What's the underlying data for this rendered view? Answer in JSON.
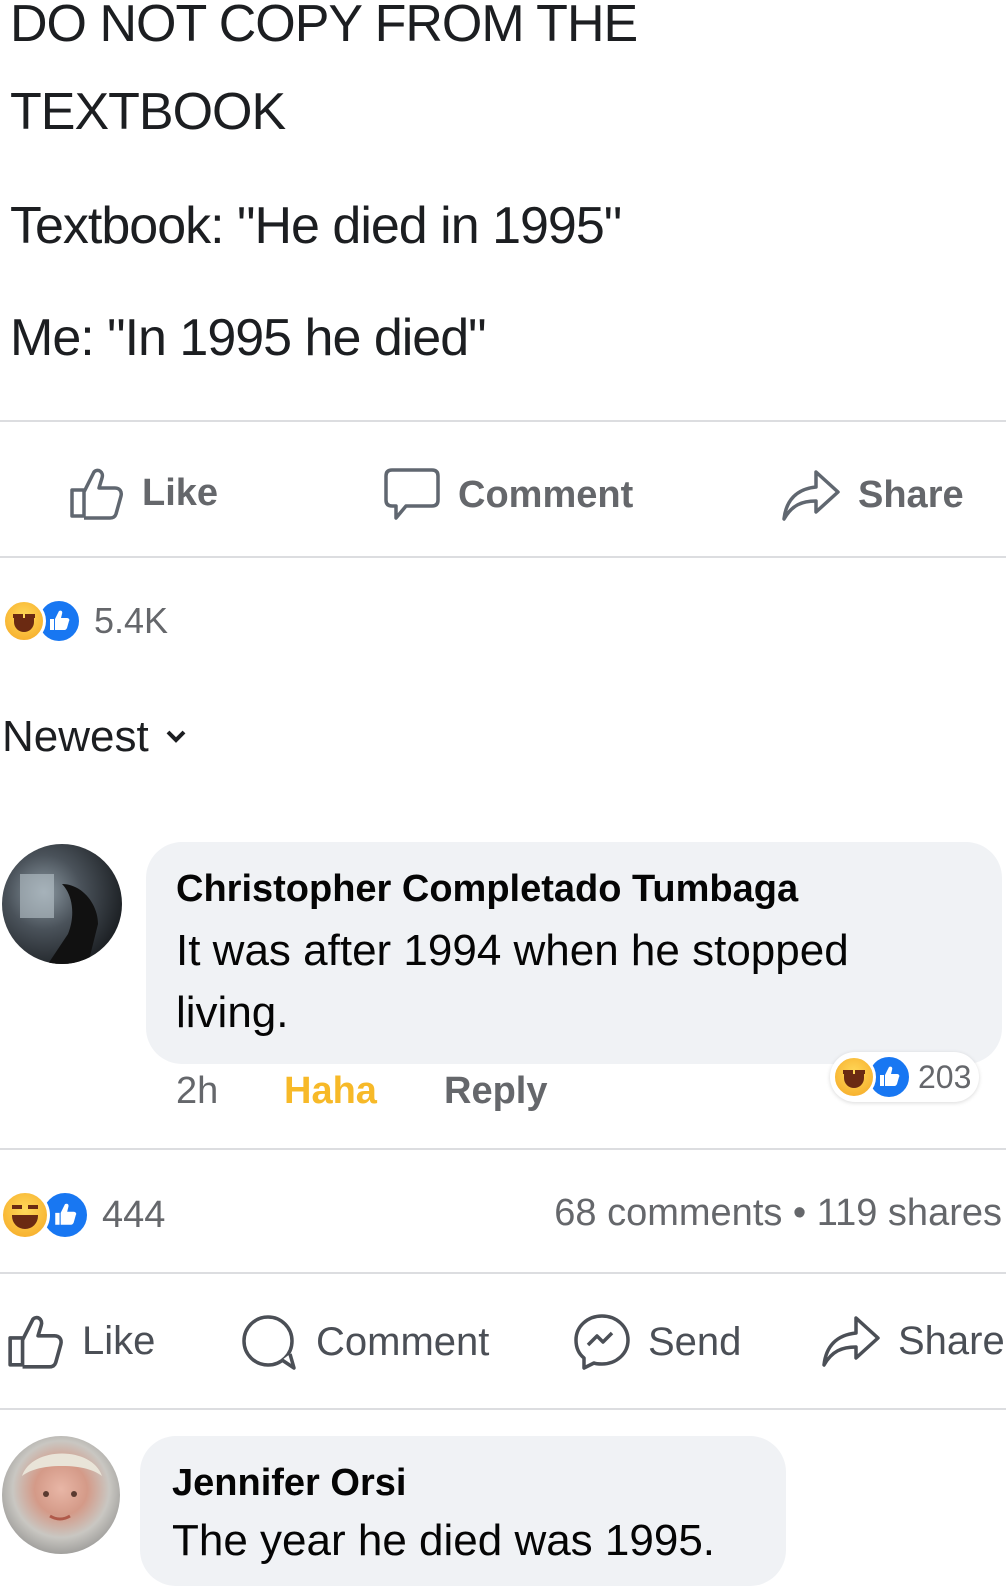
{
  "post": {
    "line1": "DO NOT COPY FROM THE",
    "line2": "TEXTBOOK",
    "line3": "Textbook: \"He died in 1995\"",
    "line4": "Me: \"In 1995 he died\""
  },
  "inner_actions": {
    "like": "Like",
    "comment": "Comment",
    "share": "Share"
  },
  "inner_reactions": {
    "count": "5.4K"
  },
  "sort": {
    "label": "Newest"
  },
  "comment1": {
    "name": "Christopher Completado Tumbaga",
    "body": "It was after 1994 when he stopped living.",
    "time": "2h",
    "haha": "Haha",
    "reply": "Reply",
    "reaction_count": "203"
  },
  "outer_reactions": {
    "count": "444",
    "stats": "68 comments • 119 shares"
  },
  "outer_actions": {
    "like": "Like",
    "comment": "Comment",
    "send": "Send",
    "share": "Share"
  },
  "comment2": {
    "name": "Jennifer Orsi",
    "body": "The year he died was 1995."
  },
  "colors": {
    "like_blue": "#1877f2",
    "haha_yellow": "#f7b928",
    "bubble_bg": "#f0f2f5",
    "muted": "#65676b"
  }
}
